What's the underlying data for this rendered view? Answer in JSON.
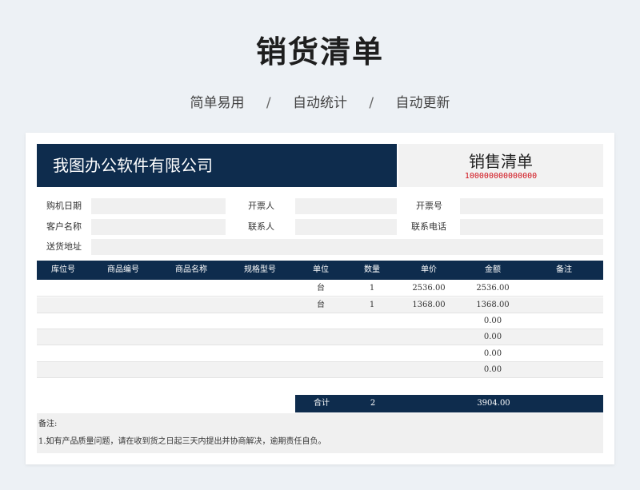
{
  "header": {
    "title": "销货清单",
    "features": [
      "简单易用",
      "自动统计",
      "自动更新"
    ],
    "separator": "/"
  },
  "form": {
    "company": "我图办公软件有限公司",
    "receipt_title": "销售清单",
    "receipt_no": "100000000000000",
    "labels": {
      "purchase_date": "购机日期",
      "issuer": "开票人",
      "invoice_no": "开票号",
      "customer": "客户名称",
      "contact": "联系人",
      "phone": "联系电话",
      "address": "送货地址"
    }
  },
  "table": {
    "headers": [
      "库位号",
      "商品编号",
      "商品名称",
      "规格型号",
      "单位",
      "数量",
      "单价",
      "金额",
      "备注"
    ],
    "rows": [
      {
        "unit": "台",
        "qty": "1",
        "price": "2536.00",
        "amount": "2536.00"
      },
      {
        "unit": "台",
        "qty": "1",
        "price": "1368.00",
        "amount": "1368.00"
      },
      {
        "unit": "",
        "qty": "",
        "price": "",
        "amount": "0.00"
      },
      {
        "unit": "",
        "qty": "",
        "price": "",
        "amount": "0.00"
      },
      {
        "unit": "",
        "qty": "",
        "price": "",
        "amount": "0.00"
      },
      {
        "unit": "",
        "qty": "",
        "price": "",
        "amount": "0.00"
      }
    ],
    "total": {
      "label": "合计",
      "qty": "2",
      "amount": "3904.00"
    }
  },
  "notes": {
    "title": "备注:",
    "line1": "1.如有产品质量问题，请在收到货之日起三天内提出并协商解决，逾期责任自负。"
  },
  "colors": {
    "navy": "#0e2c4d",
    "red": "#d0121b",
    "field_bg": "#f0f0f0"
  }
}
